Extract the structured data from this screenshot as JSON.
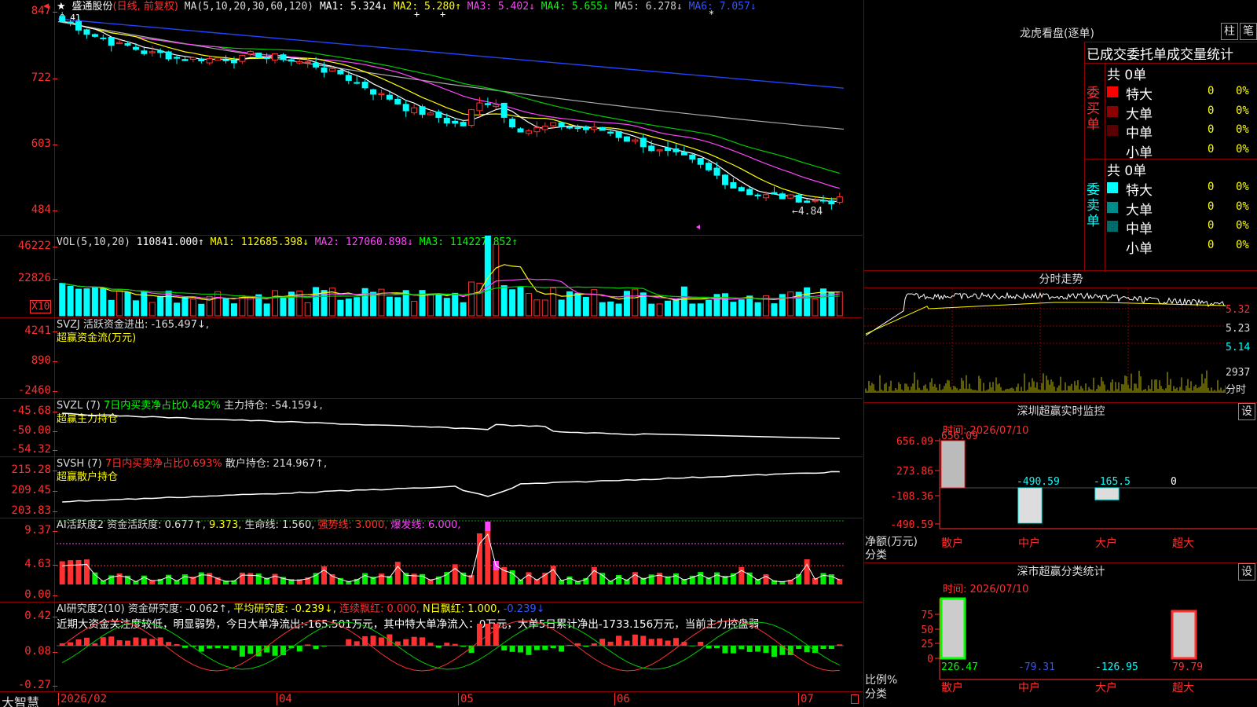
{
  "stock": {
    "star": "★",
    "name": "盛通股份",
    "mode": "(日线, 前复权)"
  },
  "ma_hdr": {
    "label": "MA(5,10,20,30,60,120)",
    "items": [
      {
        "t": "MA1: 5.324↓",
        "c": "#ffffff"
      },
      {
        "t": "MA2: 5.280↑",
        "c": "#ffff00"
      },
      {
        "t": "MA3: 5.402↓",
        "c": "#ff44ff"
      },
      {
        "t": "MA4: 5.655↓",
        "c": "#00ff00"
      },
      {
        "t": "MA5: 6.278↓",
        "c": "#cccccc"
      },
      {
        "t": "MA6: 7.057↓",
        "c": "#3355ff"
      }
    ]
  },
  "price_axis": [
    "847",
    "722",
    "603",
    "484"
  ],
  "price_low_label": "4.84",
  "price_top_label": "8.41",
  "vol_hdr": {
    "label": "VOL(5,10,20)",
    "val": "110841.000↑",
    "items": [
      {
        "t": "MA1: 112685.398↓",
        "c": "#ffff00"
      },
      {
        "t": "MA2: 127060.898↓",
        "c": "#ff44ff"
      },
      {
        "t": "MA3: 114227.852↑",
        "c": "#00ff00"
      }
    ]
  },
  "vol_axis": [
    "46222",
    "22826"
  ],
  "vol_unit": "X10",
  "svzj": {
    "line1": "SVZJ  活跃资金进出: -165.497↓,",
    "line2": "超赢资金流(万元)",
    "axis": [
      "4241",
      "890",
      "-2460"
    ]
  },
  "svzl": {
    "line1a": "SVZL (7) ",
    "line1b": "7日内买卖净占比0.482%",
    "line1c": " 主力持仓: -54.159↓,",
    "line2": "超赢主力持仓",
    "axis": [
      "-45.68",
      "-50.00",
      "-54.32"
    ]
  },
  "svsh": {
    "line1a": "SVSH (7) ",
    "line1b": "7日内买卖净占比0.693%",
    "line1c": " 散户持仓: 214.967↑,",
    "line2": "超赢散户持仓",
    "axis": [
      "215.28",
      "209.45",
      "203.83"
    ]
  },
  "ai1": {
    "items": [
      {
        "t": "AI活跃度2 资金活跃度: 0.677↑,",
        "c": "#dddddd"
      },
      {
        "t": "9.373,",
        "c": "#ffff00"
      },
      {
        "t": " 生命线: 1.560,",
        "c": "#dddddd"
      },
      {
        "t": " 强势线: 3.000,",
        "c": "#ff3030"
      },
      {
        "t": " 爆发线: 6.000,",
        "c": "#ff44ff"
      }
    ],
    "axis": [
      "9.37",
      "4.63",
      "0.00"
    ]
  },
  "ai2": {
    "items": [
      {
        "t": "AI研究度2(10) 资金研究度: -0.062↑,",
        "c": "#dddddd"
      },
      {
        "t": " 平均研究度: -0.239↓,",
        "c": "#ffff00"
      },
      {
        "t": " 连续飘红: 0.000,",
        "c": "#ff3030"
      },
      {
        "t": " N日飘红: 1.000,",
        "c": "#ffff00"
      },
      {
        "t": " -0.239↓",
        "c": "#3355ff"
      }
    ],
    "comment": "近期大资金关注度较低，明显弱势，今日大单净流出:-165.501万元，其中特大单净流入：0万元，大单5日累计净出-1733.156万元，当前主力控盘弱",
    "axis": [
      "0.42",
      "0.08",
      "-0.27"
    ]
  },
  "xaxis": {
    "brand": "大智慧",
    "labels": [
      "2026/02",
      "04",
      "05",
      "06",
      "07"
    ]
  },
  "lhb": {
    "title": "龙虎看盘(逐单)",
    "btn1": "柱",
    "btn2": "笔",
    "header": "已成交委托单成交量统计",
    "buy": {
      "side": "委买单",
      "total": "共 0单",
      "rows": [
        {
          "name": "特大",
          "v": "0",
          "p": "0%",
          "color": "#ff0000"
        },
        {
          "name": "大单",
          "v": "0",
          "p": "0%",
          "color": "#8b0000"
        },
        {
          "name": "中单",
          "v": "0",
          "p": "0%",
          "color": "#5a0000"
        },
        {
          "name": "小单",
          "v": "0",
          "p": "0%",
          "color": ""
        }
      ]
    },
    "sell": {
      "side": "委卖单",
      "total": "共 0单",
      "rows": [
        {
          "name": "特大",
          "v": "0",
          "p": "0%",
          "color": "#00ffff"
        },
        {
          "name": "大单",
          "v": "0",
          "p": "0%",
          "color": "#008b8b"
        },
        {
          "name": "中单",
          "v": "0",
          "p": "0%",
          "color": "#006b6b"
        },
        {
          "name": "小单",
          "v": "0",
          "p": "0%",
          "color": ""
        }
      ]
    }
  },
  "intraday": {
    "title": "分时走势",
    "axis": [
      "5.32",
      "5.23",
      "5.14"
    ],
    "vol": "2937",
    "vol_unit": "分时"
  },
  "monitor": {
    "title": "深圳超赢实时监控",
    "btn": "设",
    "time": "时间: 2026/07/10",
    "axis": [
      "656.09",
      "273.86",
      "-108.36",
      "-490.59"
    ],
    "ylab": "净额(万元)",
    "xlab": "分类",
    "cats": [
      "散户",
      "中户",
      "大户",
      "超大"
    ],
    "values": [
      "656.09",
      "-490.59",
      "-165.5",
      "0"
    ]
  },
  "classify": {
    "title": "深市超赢分类统计",
    "btn": "设",
    "time": "时间: 2026/07/10",
    "axis": [
      "75",
      "50",
      "25",
      "0"
    ],
    "ylab": "比例%",
    "xlab": "分类",
    "cats": [
      "散户",
      "中户",
      "大户",
      "超大"
    ],
    "values": [
      "226.47",
      "-79.31",
      "-126.95",
      "79.79"
    ]
  }
}
